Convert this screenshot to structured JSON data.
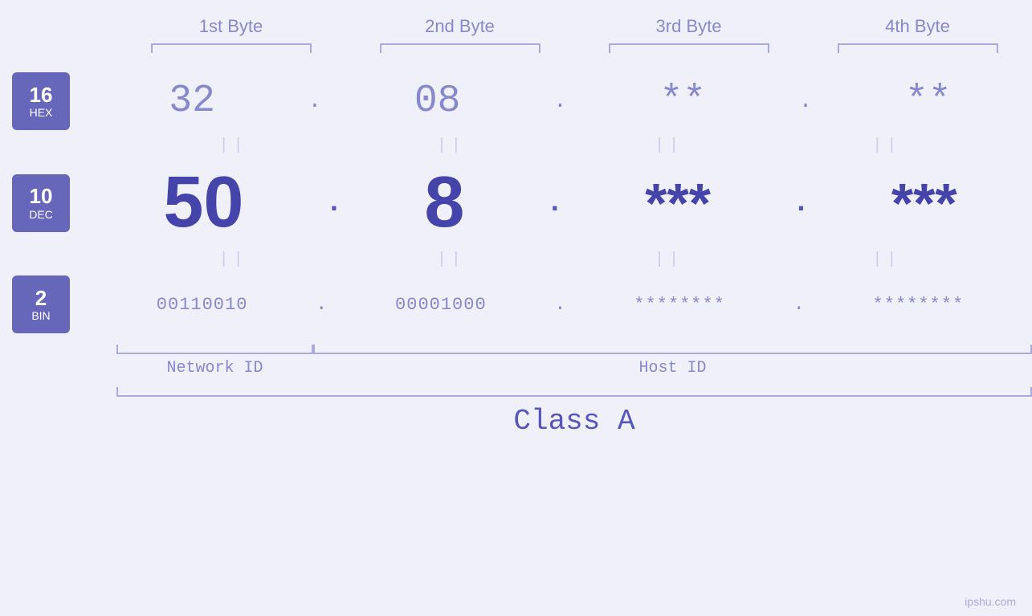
{
  "headers": {
    "byte1": "1st Byte",
    "byte2": "2nd Byte",
    "byte3": "3rd Byte",
    "byte4": "4th Byte"
  },
  "hex": {
    "badge_num": "16",
    "badge_label": "HEX",
    "val1": "32",
    "val2": "08",
    "val3": "**",
    "val4": "**",
    "dot": "."
  },
  "dec": {
    "badge_num": "10",
    "badge_label": "DEC",
    "val1": "50",
    "val2": "8",
    "val3": "***",
    "val4": "***",
    "dot": "."
  },
  "bin": {
    "badge_num": "2",
    "badge_label": "BIN",
    "val1": "00110010",
    "val2": "00001000",
    "val3": "********",
    "val4": "********",
    "dot": "."
  },
  "labels": {
    "network_id": "Network ID",
    "host_id": "Host ID",
    "class": "Class A"
  },
  "watermark": "ipshu.com",
  "equals": "||"
}
